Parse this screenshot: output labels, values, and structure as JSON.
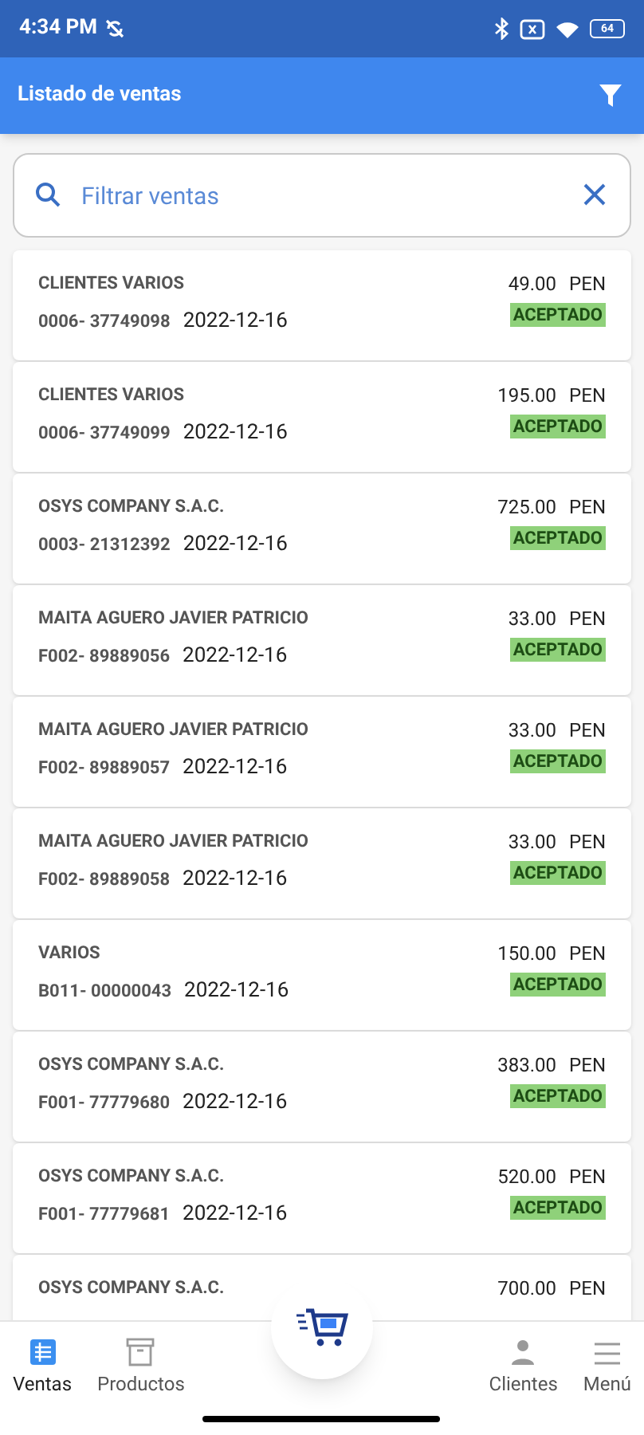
{
  "status_bar": {
    "time": "4:34 PM",
    "battery": "64"
  },
  "app_bar": {
    "title": "Listado de ventas"
  },
  "search": {
    "placeholder": "Filtrar ventas"
  },
  "sales": [
    {
      "customer": "CLIENTES VARIOS",
      "number": "0006- 37749098",
      "date": "2022-12-16",
      "amount": "49.00",
      "currency": "PEN",
      "status": "ACEPTADO"
    },
    {
      "customer": "CLIENTES VARIOS",
      "number": "0006- 37749099",
      "date": "2022-12-16",
      "amount": "195.00",
      "currency": "PEN",
      "status": "ACEPTADO"
    },
    {
      "customer": "OSYS COMPANY S.A.C.",
      "number": "0003- 21312392",
      "date": "2022-12-16",
      "amount": "725.00",
      "currency": "PEN",
      "status": "ACEPTADO"
    },
    {
      "customer": "MAITA AGUERO JAVIER PATRICIO",
      "number": "F002- 89889056",
      "date": "2022-12-16",
      "amount": "33.00",
      "currency": "PEN",
      "status": "ACEPTADO"
    },
    {
      "customer": "MAITA AGUERO JAVIER PATRICIO",
      "number": "F002- 89889057",
      "date": "2022-12-16",
      "amount": "33.00",
      "currency": "PEN",
      "status": "ACEPTADO"
    },
    {
      "customer": "MAITA AGUERO JAVIER PATRICIO",
      "number": "F002- 89889058",
      "date": "2022-12-16",
      "amount": "33.00",
      "currency": "PEN",
      "status": "ACEPTADO"
    },
    {
      "customer": "VARIOS",
      "number": "B011- 00000043",
      "date": "2022-12-16",
      "amount": "150.00",
      "currency": "PEN",
      "status": "ACEPTADO"
    },
    {
      "customer": "OSYS COMPANY S.A.C.",
      "number": "F001- 77779680",
      "date": "2022-12-16",
      "amount": "383.00",
      "currency": "PEN",
      "status": "ACEPTADO"
    },
    {
      "customer": "OSYS COMPANY S.A.C.",
      "number": "F001- 77779681",
      "date": "2022-12-16",
      "amount": "520.00",
      "currency": "PEN",
      "status": "ACEPTADO"
    },
    {
      "customer": "OSYS COMPANY S.A.C.",
      "amount": "700.00",
      "currency": "PEN"
    }
  ],
  "bottom_nav": [
    {
      "label": "Ventas",
      "kind": "sales",
      "selected": true
    },
    {
      "label": "Productos",
      "kind": "products",
      "selected": false
    },
    {
      "label": "Clientes",
      "kind": "clients",
      "selected": false
    },
    {
      "label": "Menú",
      "kind": "menu",
      "selected": false
    }
  ]
}
